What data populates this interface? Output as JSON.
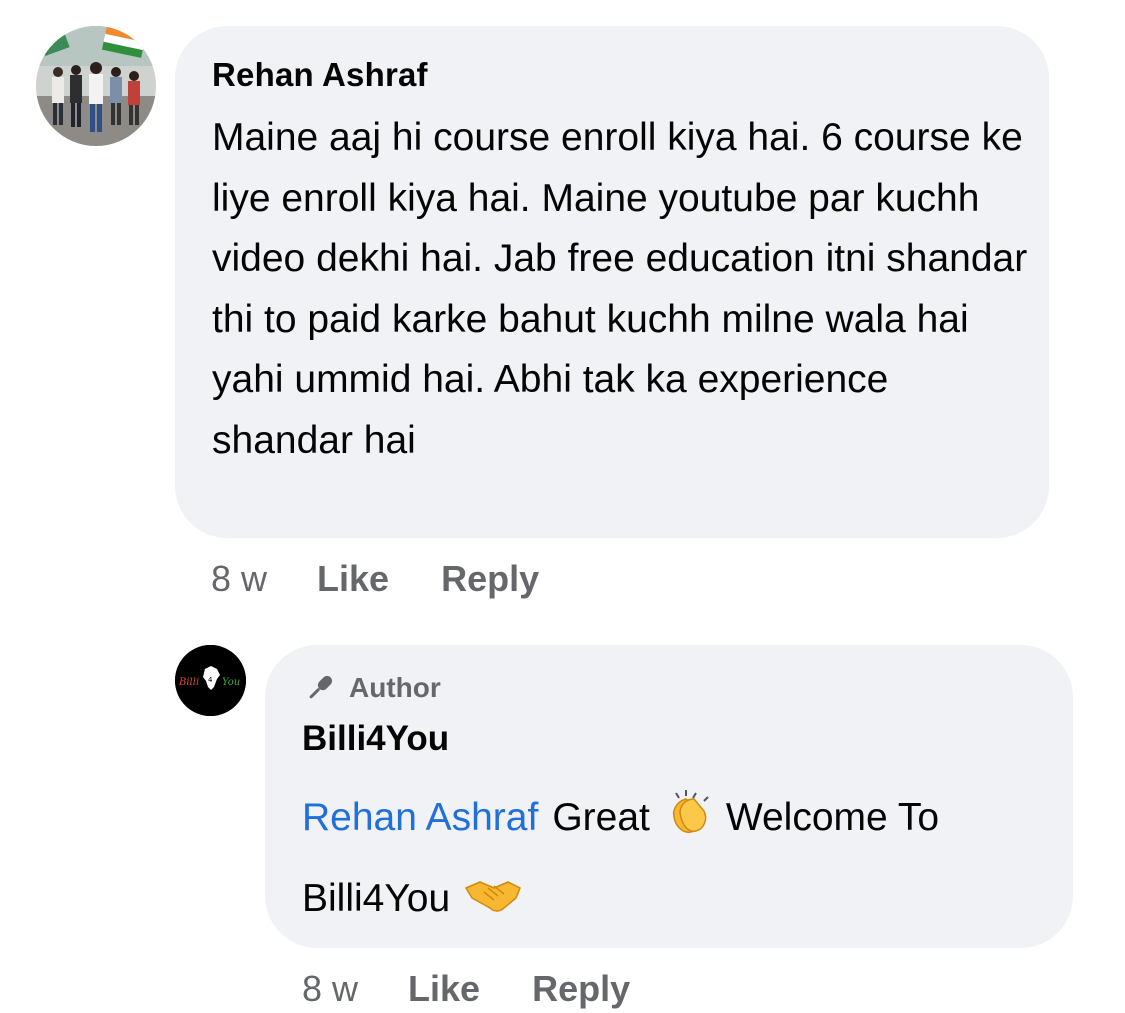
{
  "comment": {
    "author": "Rehan Ashraf",
    "body": "Maine aaj hi course enroll kiya hai. 6 course ke liye enroll kiya hai. Maine youtube par kuchh video dekhi hai. Jab free education itni shandar thi to paid karke bahut kuchh milne wala hai yahi ummid hai. Abhi tak ka experience shandar hai",
    "time": "8 w",
    "like_label": "Like",
    "reply_label": "Reply"
  },
  "reply": {
    "badge_label": "Author",
    "badge_icon": "microphone-icon",
    "author": "Billi4You",
    "mention": "Rehan Ashraf",
    "text_part1": "Great",
    "emoji1": "clapping-hands-icon",
    "text_part2": "Welcome To",
    "text_part3": "Billi4You",
    "emoji2": "handshake-icon",
    "time": "8 w",
    "like_label": "Like",
    "reply_label": "Reply"
  },
  "avatar_logo": {
    "left_text": "Billi",
    "mid_text": "4",
    "right_text": "You"
  },
  "colors": {
    "bubble": "#f0f2f5",
    "secondary_text": "#65676b",
    "mention": "#216fdb",
    "primary_text": "#050505"
  }
}
